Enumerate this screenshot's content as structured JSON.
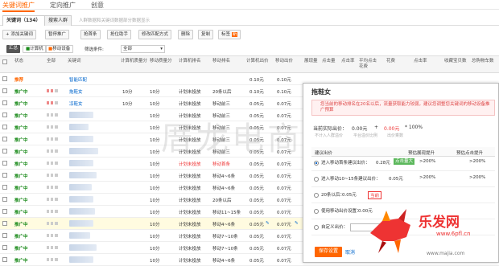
{
  "nav": {
    "tab1": "关键词推广",
    "tab2": "定向推广",
    "tab3": "创意"
  },
  "tabs": {
    "keywords": "关键词（134）",
    "search_people": "搜索人群",
    "hint": "人群数据和关键词数据部分数据显示"
  },
  "toolbar": {
    "add": "+ 添加关键词",
    "pause": "暂停推广",
    "outbid": "抢首条",
    "mobile": "抢位助手",
    "match": "修改匹配方式",
    "delete": "删除",
    "copy": "复制",
    "tag": "标签",
    "tag_flag": "新"
  },
  "filter": {
    "summary": "汇总",
    "pc": "计算机",
    "mobile": "移动设备",
    "cond_label": "筛选条件:",
    "cond_value": "全部"
  },
  "header": [
    "状态",
    "全部",
    "关键词",
    "计算机质量分",
    "移动质量分",
    "计算机排名",
    "移动排名",
    "计算机出价",
    "移动出价",
    "展现量",
    "点击量",
    "点击率",
    "平均点击花费",
    "花费",
    "点击率",
    "收藏宝贝数",
    "总购物车数"
  ],
  "rows": [
    {
      "status": "推荐",
      "keyword": "智能匹配",
      "pc_q": "",
      "m_q": "",
      "pc_rank": "",
      "m_rank": "",
      "pc_bid": "0.10元",
      "m_bid": "0.10元",
      "orange": true
    },
    {
      "status": "推广中",
      "keyword": "拖鞋女",
      "pc_q": "10分",
      "m_q": "10分",
      "pc_rank": "计划未投放",
      "m_rank": "20条以后",
      "pc_bid": "0.10元",
      "m_bid": "0.10元"
    },
    {
      "status": "推广中",
      "keyword": "凉鞋女",
      "pc_q": "10分",
      "m_q": "10分",
      "pc_rank": "计划未投放",
      "m_rank": "移动前三",
      "pc_bid": "0.05元",
      "m_bid": "0.07元"
    },
    {
      "status": "推广中",
      "keyword": "",
      "pc_q": "",
      "m_q": "10分",
      "pc_rank": "计划未投放",
      "m_rank": "移动前三",
      "pc_bid": "0.05元",
      "m_bid": "0.07元"
    },
    {
      "status": "推广中",
      "keyword": "",
      "pc_q": "",
      "m_q": "10分",
      "pc_rank": "计划未投放",
      "m_rank": "移动前三",
      "pc_bid": "0.05元",
      "m_bid": "0.07元"
    },
    {
      "status": "推广中",
      "keyword": "",
      "pc_q": "",
      "m_q": "10分",
      "pc_rank": "计划未投放",
      "m_rank": "移动前三",
      "pc_bid": "0.05元",
      "m_bid": "0.07元"
    },
    {
      "status": "推广中",
      "keyword": "",
      "pc_q": "",
      "m_q": "10分",
      "pc_rank": "计划未投放",
      "m_rank": "移动前三",
      "pc_bid": "0.05元",
      "m_bid": "0.07元"
    },
    {
      "status": "推广中",
      "keyword": "",
      "pc_q": "",
      "m_q": "10分",
      "pc_rank": "计划未投放",
      "m_rank": "移动首条",
      "pc_bid": "0.05元",
      "m_bid": "0.07元",
      "red": true
    },
    {
      "status": "推广中",
      "keyword": "",
      "pc_q": "",
      "m_q": "10分",
      "pc_rank": "计划未投放",
      "m_rank": "移动4~6条",
      "pc_bid": "0.05元",
      "m_bid": "0.07元"
    },
    {
      "status": "推广中",
      "keyword": "",
      "pc_q": "",
      "m_q": "10分",
      "pc_rank": "计划未投放",
      "m_rank": "移动4~6条",
      "pc_bid": "0.05元",
      "m_bid": "0.07元"
    },
    {
      "status": "推广中",
      "keyword": "",
      "pc_q": "",
      "m_q": "10分",
      "pc_rank": "计划未投放",
      "m_rank": "20条以后",
      "pc_bid": "0.05元",
      "m_bid": "0.07元"
    },
    {
      "status": "推广中",
      "keyword": "",
      "pc_q": "",
      "m_q": "10分",
      "pc_rank": "计划未投放",
      "m_rank": "移动11~15条",
      "pc_bid": "0.05元",
      "m_bid": "0.07元"
    },
    {
      "status": "推广中",
      "keyword": "",
      "pc_q": "",
      "m_q": "10分",
      "pc_rank": "计划未投放",
      "m_rank": "移动4~6条",
      "pc_bid": "0.05元",
      "m_bid": "0.07元"
    },
    {
      "status": "推广中",
      "keyword": "",
      "pc_q": "",
      "m_q": "10分",
      "pc_rank": "计划未投放",
      "m_rank": "移动7~10条",
      "pc_bid": "0.05元",
      "m_bid": "0.07元"
    },
    {
      "status": "推广中",
      "keyword": "",
      "pc_q": "",
      "m_q": "10分",
      "pc_rank": "计划未投放",
      "m_rank": "移动7~10条",
      "pc_bid": "0.05元",
      "m_bid": "0.07元"
    },
    {
      "status": "推广中",
      "keyword": "",
      "pc_q": "",
      "m_q": "10分",
      "pc_rank": "计划未投放",
      "m_rank": "移动4~6条",
      "pc_bid": "0.05元",
      "m_bid": "0.07元"
    }
  ],
  "popup": {
    "title": "拖鞋女",
    "warning": "您当前的移动排名在20名以后，流量获取能力较弱，建议您调整您关键词的移动设备推广预算",
    "current_bid_label": "当前实际出价：",
    "current_bid": "0.00元",
    "plus": "+",
    "premium": "0.00元",
    "premium_pct": "* 100%",
    "sub_note1": "平台溢价比例",
    "sub_note2": "出价乘数",
    "sub_note3": "不计入人群溢价",
    "col1": "建议出价",
    "col2": "预估展现提升",
    "col3": "预估点击提升",
    "options": [
      {
        "label": "进入移动首条建议出价：",
        "value": "0.28元",
        "badge": "点击量大",
        "pv": ">200%",
        "click": ">200%",
        "on": true
      },
      {
        "label": "进入移动10~15条建议出价：",
        "value": "0.05元",
        "badge": "",
        "pv": ">200%",
        "click": ">200%"
      },
      {
        "label": "20条以后：",
        "value": "0.05元",
        "badge": "当前",
        "pv": "",
        "click": ""
      },
      {
        "label": "使用移动出价设置：",
        "value": "0.00元",
        "badge": "",
        "pv": "",
        "click": ""
      },
      {
        "label": "自定义出价：",
        "value": "",
        "badge": "",
        "pv": "",
        "click": ""
      }
    ],
    "save": "保存设置",
    "cancel": "取消"
  },
  "watermark": "厝龙电商",
  "logo": {
    "main": "乐发网",
    "url": "www.6pfl.cn",
    "site": "www.majia.com"
  }
}
